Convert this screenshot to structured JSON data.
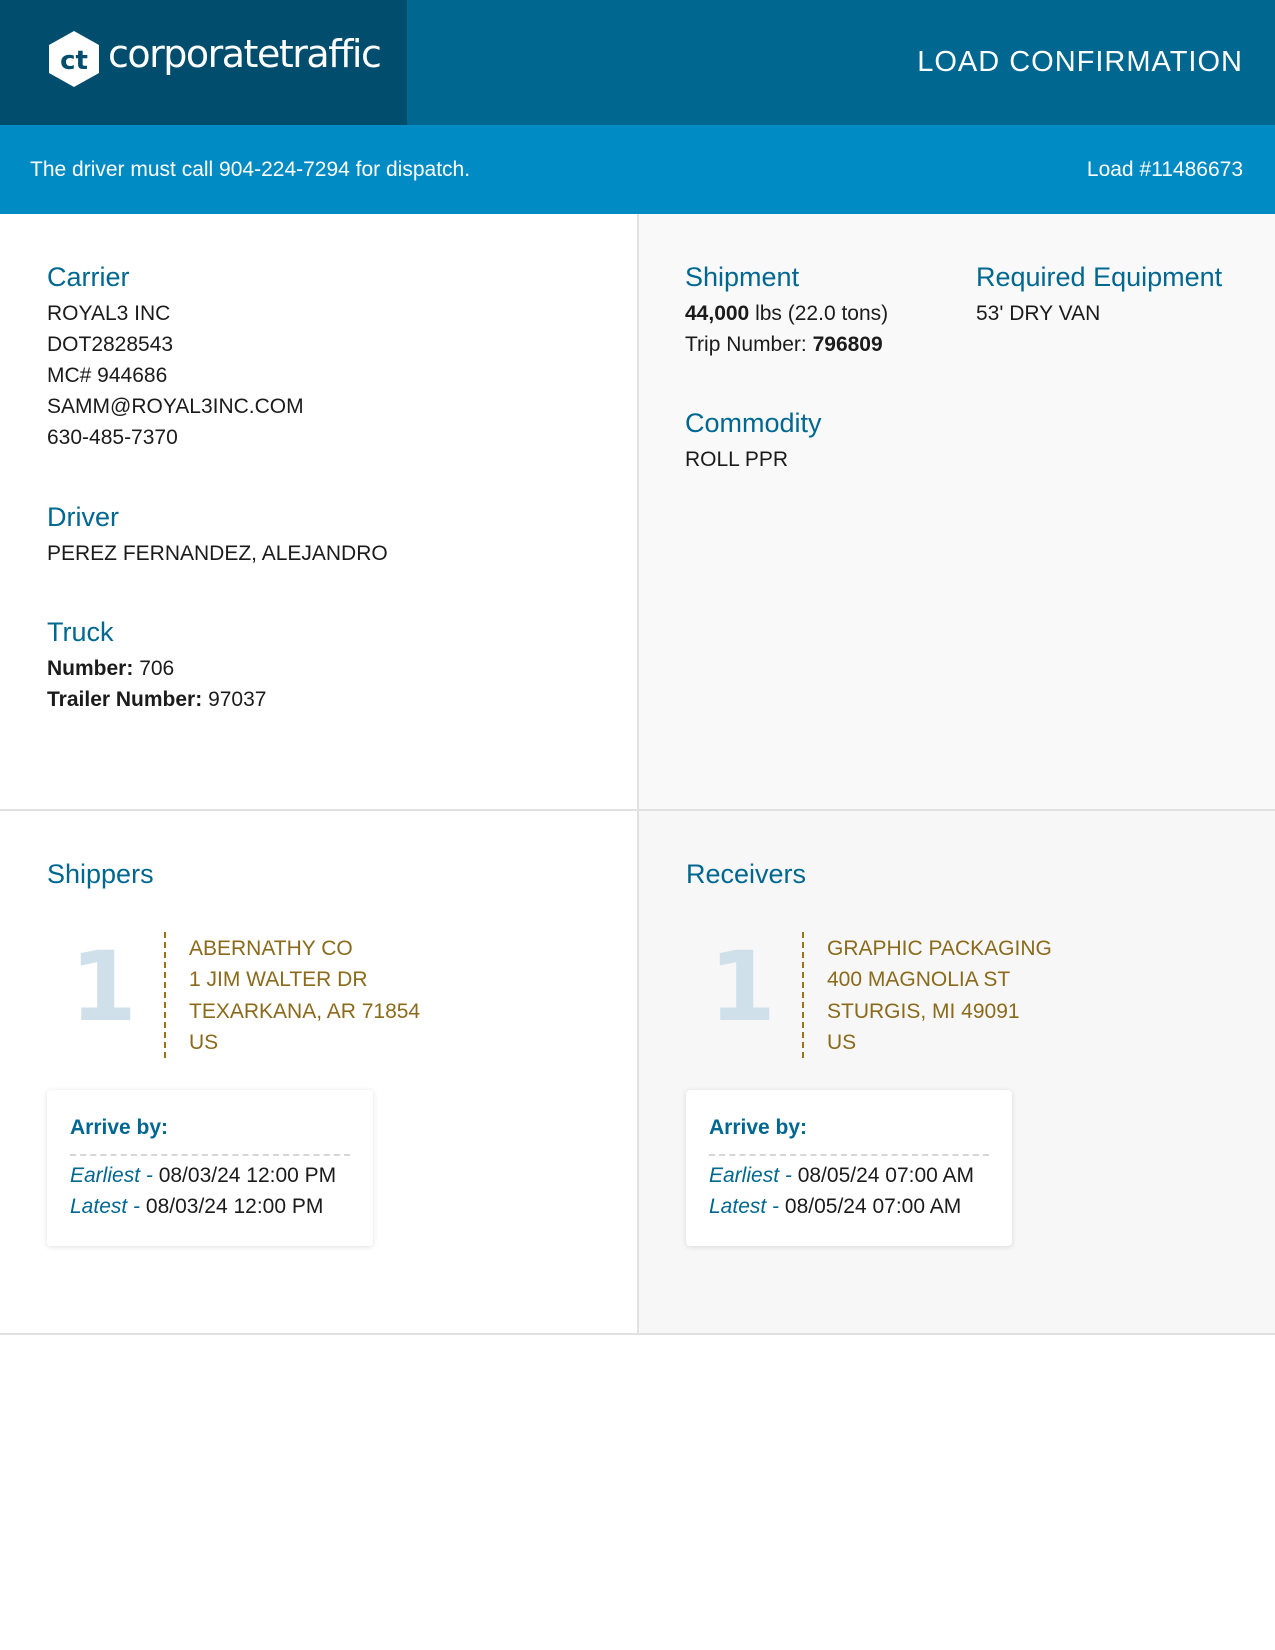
{
  "header": {
    "brand": "corporatetraffic",
    "logo_mark": "ct",
    "title": "LOAD CONFIRMATION"
  },
  "dispatch_bar": {
    "message": "The driver must call 904-224-7294 for dispatch.",
    "load_number": "Load #11486673"
  },
  "carrier": {
    "heading": "Carrier",
    "lines": [
      "ROYAL3 INC",
      "DOT2828543",
      "MC# 944686",
      "SAMM@ROYAL3INC.COM",
      "630-485-7370"
    ]
  },
  "driver": {
    "heading": "Driver",
    "name": "PEREZ FERNANDEZ, ALEJANDRO"
  },
  "truck": {
    "heading": "Truck",
    "number_label": "Number:",
    "number": "706",
    "trailer_label": "Trailer Number:",
    "trailer": "97037"
  },
  "shipment": {
    "heading": "Shipment",
    "weight": "44,000",
    "weight_unit": "lbs (22.0 tons)",
    "trip_label": "Trip Number:",
    "trip_number": "796809"
  },
  "equipment": {
    "heading": "Required Equipment",
    "value": "53' DRY VAN"
  },
  "commodity": {
    "heading": "Commodity",
    "value": "ROLL PPR"
  },
  "shippers": {
    "heading": "Shippers",
    "stop_number": "1",
    "address": [
      "ABERNATHY CO",
      "1 JIM WALTER DR",
      "TEXARKANA, AR 71854",
      "US"
    ],
    "arrive_label": "Arrive by:",
    "earliest_label": "Earliest -",
    "earliest": "08/03/24 12:00 PM",
    "latest_label": "Latest -",
    "latest": "08/03/24 12:00 PM"
  },
  "receivers": {
    "heading": "Receivers",
    "stop_number": "1",
    "address": [
      "GRAPHIC PACKAGING",
      "400 MAGNOLIA ST",
      "STURGIS, MI 49091",
      "US"
    ],
    "arrive_label": "Arrive by:",
    "earliest_label": "Earliest -",
    "earliest": "08/05/24 07:00 AM",
    "latest_label": "Latest -",
    "latest": "08/05/24 07:00 AM"
  }
}
